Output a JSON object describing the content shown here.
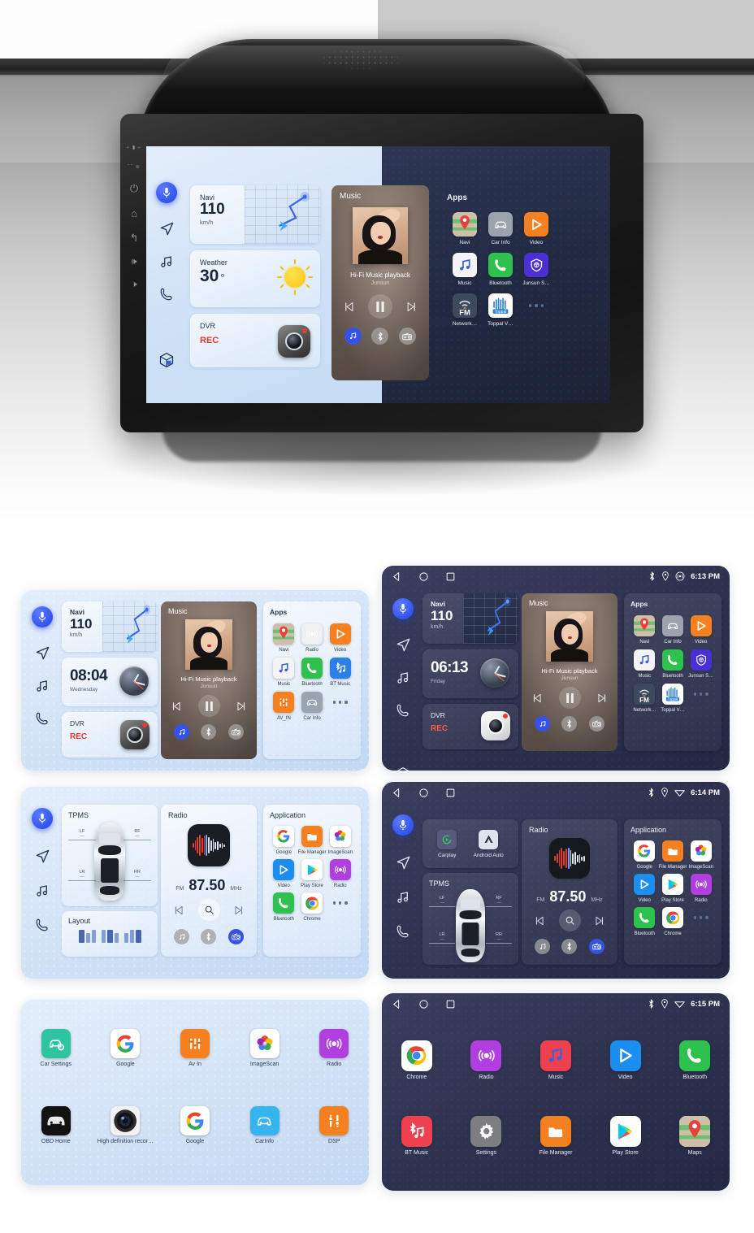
{
  "product": {
    "brand": "Junsun",
    "device_name": "Car Head Unit"
  },
  "hero": {
    "screen_left_theme": "light",
    "screen_right_theme": "dark",
    "bezel_buttons": [
      "power-button",
      "home-button",
      "back-button",
      "volume-up-button",
      "volume-down-button"
    ]
  },
  "sidebar": {
    "items": [
      {
        "name": "voice-assistant",
        "icon": "microphone-icon",
        "active": true
      },
      {
        "name": "navigation",
        "icon": "navigation-arrow-icon",
        "active": false
      },
      {
        "name": "music",
        "icon": "music-note-icon",
        "active": false
      },
      {
        "name": "phone",
        "icon": "phone-icon",
        "active": false
      },
      {
        "name": "apps",
        "icon": "cube-apps-icon",
        "active": false
      }
    ]
  },
  "statusbar": {
    "nav_icons": [
      "back-triangle-icon",
      "home-circle-icon",
      "recents-square-icon"
    ],
    "indicator_icons": [
      "bluetooth-icon",
      "location-icon",
      "wifi-icon"
    ],
    "times": {
      "card2": "6:13 PM",
      "card4": "6:14 PM",
      "card6": "6:15 PM"
    }
  },
  "widgets": {
    "navi": {
      "title": "Navi",
      "value": "110",
      "unit": "km/h"
    },
    "weather": {
      "title": "Weather",
      "value": "30",
      "degree": "°",
      "icon": "sun-icon"
    },
    "dvr": {
      "title": "DVR",
      "status": "REC",
      "icon": "dashcam-icon"
    },
    "clock_light": {
      "time": "08:04",
      "day": "Wednesday"
    },
    "clock_dark": {
      "time": "06:13",
      "day": "Friday"
    },
    "tpms": {
      "title": "TPMS",
      "corners": [
        {
          "label": "LF",
          "value": "—"
        },
        {
          "label": "RF",
          "value": "—"
        },
        {
          "label": "LR",
          "value": "—"
        },
        {
          "label": "RR",
          "value": "—"
        }
      ]
    },
    "layout": {
      "title": "Layout",
      "options": 3
    },
    "radio": {
      "title": "Radio",
      "band": "FM",
      "frequency": "87.50",
      "unit": "MHz",
      "icon": "radio-waveform-icon",
      "controls": [
        "prev-icon",
        "search-icon",
        "next-icon"
      ]
    },
    "projection": {
      "items": [
        {
          "label": "Carplay",
          "icon": "carplay-icon"
        },
        {
          "label": "Android Auto",
          "icon": "android-auto-icon"
        }
      ]
    }
  },
  "music": {
    "title": "Music",
    "track": "Hi-Fi Music playback",
    "artist": "Junsun",
    "controls": [
      "prev-track-icon",
      "pause-icon",
      "next-track-icon"
    ],
    "sources": [
      {
        "name": "local-music-source",
        "icon": "music-note-icon",
        "active": true
      },
      {
        "name": "bluetooth-source",
        "icon": "bluetooth-icon",
        "active": false
      },
      {
        "name": "radio-source",
        "icon": "radio-icon",
        "active": false
      }
    ]
  },
  "panels": {
    "apps_title": "Apps",
    "application_title": "Application"
  },
  "apps": {
    "hero_dark": [
      {
        "label": "Navi",
        "icon": "maps-pin-icon",
        "color": "#3f8de0"
      },
      {
        "label": "Car Info",
        "icon": "car-icon",
        "color": "#9aa3ae"
      },
      {
        "label": "Video",
        "icon": "video-play-icon",
        "color": "#f5801f"
      },
      {
        "label": "Music",
        "icon": "music-note-icon",
        "color": "#f4f4f6"
      },
      {
        "label": "Bluetooth",
        "icon": "phone-icon",
        "color": "#2fc14e"
      },
      {
        "label": "Junsun S…",
        "icon": "shield-icon",
        "color": "#4a2fd6"
      },
      {
        "label": "Network…",
        "icon": "fm-antenna-icon",
        "color": "#3c4a5e"
      },
      {
        "label": "Toppal V…",
        "icon": "toppal-icon",
        "color": "#ffffff"
      },
      {
        "label": "",
        "icon": "more-dots-icon",
        "color": "transparent"
      }
    ],
    "card1_light": [
      {
        "label": "Navi",
        "icon": "maps-pin-icon",
        "color": "#3f8de0"
      },
      {
        "label": "Radio",
        "icon": "radio-icon",
        "color": "#f0f0f2"
      },
      {
        "label": "Video",
        "icon": "video-play-icon",
        "color": "#f5801f"
      },
      {
        "label": "Music",
        "icon": "music-note-icon",
        "color": "#f4f4f6"
      },
      {
        "label": "Bluetooth",
        "icon": "phone-icon",
        "color": "#2fc14e"
      },
      {
        "label": "BT Music",
        "icon": "bt-music-icon",
        "color": "#2a7fe8"
      },
      {
        "label": "AV_IN",
        "icon": "av-in-icon",
        "color": "#f5801f"
      },
      {
        "label": "Car Info",
        "icon": "car-icon",
        "color": "#9aa3ae"
      },
      {
        "label": "",
        "icon": "more-dots-icon",
        "color": "transparent"
      }
    ],
    "application_list": [
      {
        "label": "Google",
        "icon": "google-g-icon",
        "color": "#ffffff"
      },
      {
        "label": "File Manager",
        "icon": "folder-icon",
        "color": "#f5801f"
      },
      {
        "label": "ImageScan",
        "icon": "photos-icon",
        "color": "#ffffff"
      },
      {
        "label": "Video",
        "icon": "video-play-icon",
        "color": "#1b8ef0"
      },
      {
        "label": "Play Store",
        "icon": "play-store-icon",
        "color": "#ffffff"
      },
      {
        "label": "Radio",
        "icon": "radio-icon",
        "color": "#b13fe0"
      },
      {
        "label": "Bluetooth",
        "icon": "phone-icon",
        "color": "#2fc14e"
      },
      {
        "label": "Chrome",
        "icon": "chrome-icon",
        "color": "#ffffff"
      },
      {
        "label": "",
        "icon": "more-dots-icon",
        "color": "transparent"
      }
    ],
    "drawer_light": [
      {
        "label": "Car Settings",
        "icon": "car-settings-icon",
        "color": "#2ec4a0"
      },
      {
        "label": "Google",
        "icon": "google-g-icon",
        "color": "#ffffff"
      },
      {
        "label": "Av In",
        "icon": "av-in-icon",
        "color": "#f5801f"
      },
      {
        "label": "ImageScan",
        "icon": "photos-icon",
        "color": "#ffffff"
      },
      {
        "label": "Radio",
        "icon": "radio-icon",
        "color": "#b13fe0"
      },
      {
        "label": "OBD Home",
        "icon": "obd-car-icon",
        "color": "#111111"
      },
      {
        "label": "High definition recor…",
        "icon": "camera-lens-icon",
        "color": "#f2f2f4"
      },
      {
        "label": "Google",
        "icon": "google-g-icon",
        "color": "#ffffff"
      },
      {
        "label": "CarInfo",
        "icon": "car-icon",
        "color": "#36b4ef"
      },
      {
        "label": "DSP",
        "icon": "dsp-sliders-icon",
        "color": "#f5801f"
      }
    ],
    "drawer_dark": [
      {
        "label": "Chrome",
        "icon": "chrome-icon",
        "color": "#ffffff"
      },
      {
        "label": "Radio",
        "icon": "radio-icon",
        "color": "#b13fe0"
      },
      {
        "label": "Music",
        "icon": "music-note-icon",
        "color": "#ef4050"
      },
      {
        "label": "Video",
        "icon": "video-play-icon",
        "color": "#1b8ef0"
      },
      {
        "label": "Bluetooth",
        "icon": "phone-icon",
        "color": "#2fc14e"
      },
      {
        "label": "BT Music",
        "icon": "bt-music-icon",
        "color": "#ef4050"
      },
      {
        "label": "Settings",
        "icon": "gear-icon",
        "color": "#7d7d82"
      },
      {
        "label": "File Manager",
        "icon": "folder-icon",
        "color": "#f5801f"
      },
      {
        "label": "Play Store",
        "icon": "play-store-icon",
        "color": "#ffffff"
      },
      {
        "label": "Maps",
        "icon": "maps-pin-icon",
        "color": "#ffffff"
      }
    ]
  },
  "colors": {
    "accent_blue": "#3552e8",
    "rec_red": "#e0392f",
    "light_bg": "#d3e3f7",
    "dark_bg": "#2e3350"
  }
}
